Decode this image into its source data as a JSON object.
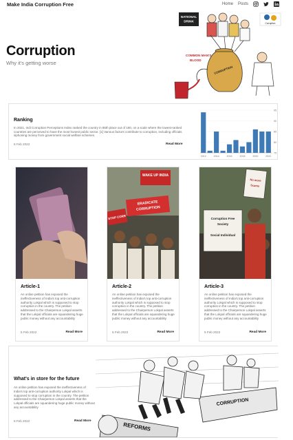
{
  "nav": {
    "brand": "Make India Corruption Free",
    "links": [
      "Home",
      "Posts"
    ],
    "social": [
      "instagram-icon",
      "twitter-icon",
      "linkedin-icon"
    ]
  },
  "hero": {
    "title": "Corruption",
    "subtitle": "Why it's getting worse",
    "art_labels": {
      "sign": "NATIONAL DRINK",
      "pot_label": "COMMON MAN'S BLOOD",
      "pot_text": "CORRUPTION",
      "corner": "Corruption"
    }
  },
  "ranking": {
    "title": "Ranking",
    "text": "In 2021, Indi Corruption Perceptions Index ranked the country in 85th place out of 180, on a scale where the lowest-ranked countries are perceived to have the most honest public sector. [1] Various factors contribute to corruption, including officials siphoning money from government social welfare schemes.",
    "date": "5 Feb 2022",
    "more": "Read More"
  },
  "chart_data": {
    "type": "bar",
    "categories": [
      "2012",
      "2013",
      "2014",
      "2015",
      "2016",
      "2017",
      "2018",
      "2019",
      "2020",
      "2021",
      "2022"
    ],
    "values": [
      94,
      76,
      85,
      76,
      79,
      81,
      78,
      80,
      86,
      85,
      85
    ],
    "xticks": [
      "2012",
      "2014",
      "2016",
      "2018",
      "2020",
      "2022"
    ],
    "yticks": [
      "95",
      "90",
      "85",
      "80",
      "75"
    ],
    "ylim": [
      75,
      95
    ],
    "color": "#3e7ab6"
  },
  "articles": [
    {
      "title": "Article-1",
      "text": "An online petition has exposed the ineffectiveness of India's top anti-corruption authority Lokpal which is supposed to stop corruption in the country. The petition addressed to the Chairperson Lokpal asserts that the Lokpal officials are squandering huge public money without any accountability",
      "date": "5 Feb 2022",
      "more": "Read More"
    },
    {
      "title": "Article-2",
      "text": "An online petition has exposed the ineffectiveness of India's top anti-corruption authority Lokpal which is supposed to stop corruption in the country. The petition addressed to the Chairperson Lokpal asserts that the Lokpal officials are squandering huge public money without any accountability",
      "date": "5 Feb 2022",
      "more": "Read More",
      "signs": [
        "WAKE UP INDIA",
        "ERADICATE CORRUPTION",
        "STOP CORR"
      ]
    },
    {
      "title": "Article-3",
      "text": "An online petition has exposed the ineffectiveness of India's top anti-corruption authority Lokpal which is supposed to stop corruption in the country. The petition addressed to the Chairperson Lokpal asserts that the Lokpal officials are squandering huge public money without any accountability",
      "date": "5 Feb 2022",
      "more": "Read More",
      "signs": [
        "Corruption Free Society",
        "Social Individual",
        "No more Scams"
      ]
    }
  ],
  "future": {
    "title": "What's in store for the future",
    "text": "An online petition has exposed the ineffectiveness of India's top anti-corruption authority Lokpal which is supposed to stop corruption in the country. The petition addressed to the Chairperson Lokpal asserts that the Lokpal officials are squandering huge public money without any accountability",
    "date": "5 Feb 2022",
    "more": "Read More",
    "art_labels": {
      "carpet": "CORRUPTION",
      "roll": "REFORMS"
    }
  }
}
